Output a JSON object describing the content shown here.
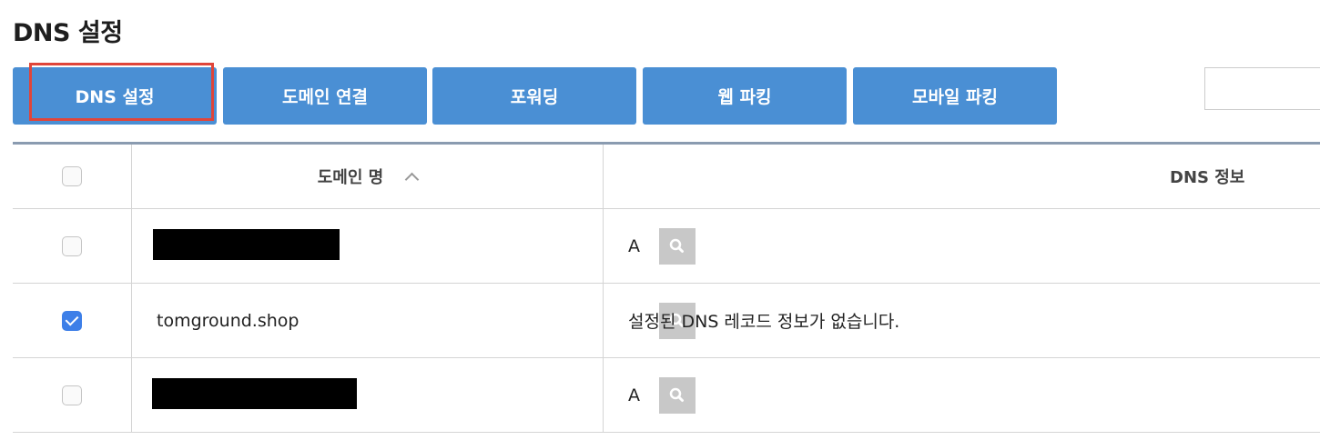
{
  "page": {
    "title": "DNS 설정"
  },
  "toolbar": {
    "buttons": [
      {
        "label": "DNS 설정"
      },
      {
        "label": "도메인 연결"
      },
      {
        "label": "포워딩"
      },
      {
        "label": "웹 파킹"
      },
      {
        "label": "모바일 파킹"
      }
    ],
    "search_value": ""
  },
  "table": {
    "headers": {
      "domain": "도메인 명",
      "dns": "DNS 정보"
    },
    "rows": [
      {
        "checked": false,
        "domain": "",
        "domain_redacted": true,
        "dns_info": "A"
      },
      {
        "checked": true,
        "domain": "tomground.shop",
        "domain_redacted": false,
        "dns_info": "설정된 DNS 레코드 정보가 없습니다."
      },
      {
        "checked": false,
        "domain": "",
        "domain_redacted": true,
        "dns_info": "A"
      }
    ]
  },
  "icons": {
    "sort": "chevron-up-icon",
    "row_action": "search-icon"
  },
  "colors": {
    "accent": "#4a8fd4",
    "highlight": "#e0453a",
    "checkbox_checked": "#3d7fe8"
  }
}
